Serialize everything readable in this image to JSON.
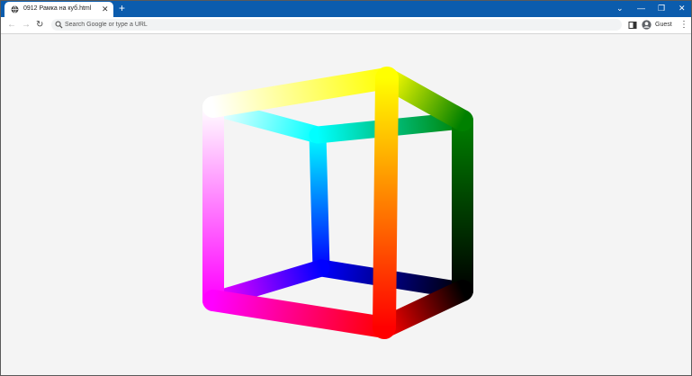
{
  "window": {
    "tab": {
      "title": "0912 Рамка на куб.html",
      "favicon": "globe-icon",
      "close_icon": "close-icon"
    },
    "new_tab_icon": "plus-icon",
    "controls": [
      "chevron-down-icon",
      "minimize-icon",
      "restore-icon",
      "close-icon"
    ],
    "accent_color": "#0b5cad"
  },
  "toolbar": {
    "back_icon": "arrow-left-icon",
    "forward_icon": "arrow-right-icon",
    "reload_icon": "reload-icon",
    "omnibox": {
      "placeholder": "Search Google or type a URL",
      "value": "",
      "icon": "search-icon"
    },
    "side_panel_icon": "side-panel-icon",
    "profile": {
      "label": "Guest",
      "icon": "avatar-icon"
    },
    "menu_icon": "kebab-menu-icon"
  },
  "page": {
    "background_color": "#f4f4f4",
    "scene": "rgb-color-cube-wireframe",
    "vertex_colors": {
      "white": "#ffffff",
      "yellow": "#ffff00",
      "green": "#008000",
      "cyan": "#00ffff",
      "magenta": "#ff00ff",
      "red": "#ff0000",
      "black": "#000000",
      "blue": "#0000ff"
    }
  }
}
